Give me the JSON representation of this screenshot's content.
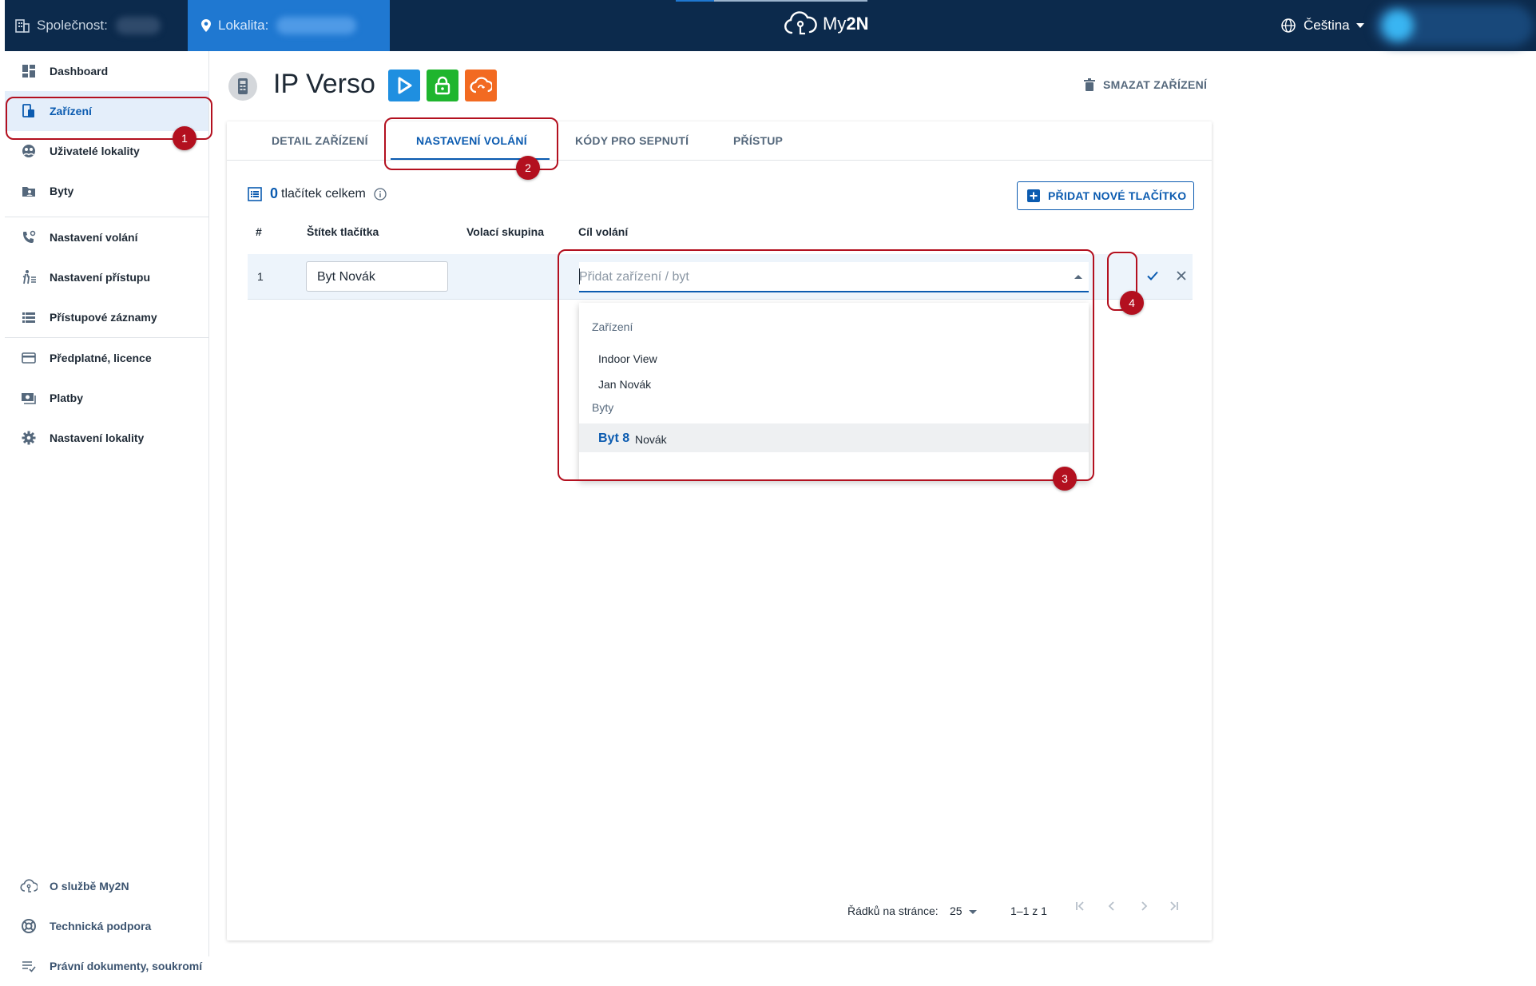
{
  "topbar": {
    "company_label": "Společnost:",
    "location_label": "Lokalita:",
    "logo_text_a": "My",
    "logo_text_b": "2N",
    "language": "Čeština"
  },
  "sidebar": {
    "items": [
      {
        "label": "Dashboard",
        "icon": "dashboard-icon"
      },
      {
        "label": "Zařízení",
        "icon": "device-icon",
        "active": true
      },
      {
        "label": "Uživatelé lokality",
        "icon": "users-icon"
      },
      {
        "label": "Byty",
        "icon": "apartments-icon"
      },
      {
        "label": "Nastavení volání",
        "icon": "phone-settings-icon"
      },
      {
        "label": "Nastavení přístupu",
        "icon": "access-icon"
      },
      {
        "label": "Přístupové záznamy",
        "icon": "list-icon"
      },
      {
        "label": "Předplatné, licence",
        "icon": "card-icon"
      },
      {
        "label": "Platby",
        "icon": "payment-icon"
      },
      {
        "label": "Nastavení lokality",
        "icon": "gear-icon"
      }
    ],
    "footer": [
      {
        "label": "O službě My2N",
        "icon": "cloud-icon"
      },
      {
        "label": "Technická podpora",
        "icon": "lifebuoy-icon"
      },
      {
        "label": "Právní dokumenty, soukromí",
        "icon": "doc-list-icon"
      }
    ]
  },
  "device": {
    "title": "IP Verso",
    "service_colors": {
      "blue": "#1f8fe0",
      "green": "#1fb52e",
      "orange": "#f26a21"
    },
    "delete_label": "SMAZAT ZAŘÍZENÍ"
  },
  "tabs": [
    "DETAIL ZAŘÍZENÍ",
    "NASTAVENÍ VOLÁNÍ",
    "KÓDY PRO SEPNUTÍ",
    "PŘÍSTUP"
  ],
  "active_tab": 1,
  "buttons_summary": {
    "count": "0",
    "text": "tlačítek celkem"
  },
  "add_button_label": "PŘIDAT NOVÉ TLAČÍTKO",
  "table": {
    "headers": [
      "#",
      "Štítek tlačítka",
      "Volací skupina",
      "Cíl volání"
    ],
    "row": {
      "num": "1",
      "label_value": "Byt  Novák",
      "target_placeholder": "Přidat zařízení / byt"
    }
  },
  "dropdown": {
    "group_devices": "Zařízení",
    "devices": [
      "Indoor View",
      "Jan Novák"
    ],
    "group_apartments": "Byty",
    "apartment": {
      "name": "Byt 8",
      "owner": "Novák"
    }
  },
  "pagination": {
    "rows_label": "Řádků na stránce:",
    "rows_value": "25",
    "range": "1–1 z 1"
  },
  "annotations": [
    "1",
    "2",
    "3",
    "4"
  ],
  "colors": {
    "topbar": "#0c2a4c",
    "accent": "#0b5bb0",
    "annotation": "#b3101f"
  }
}
